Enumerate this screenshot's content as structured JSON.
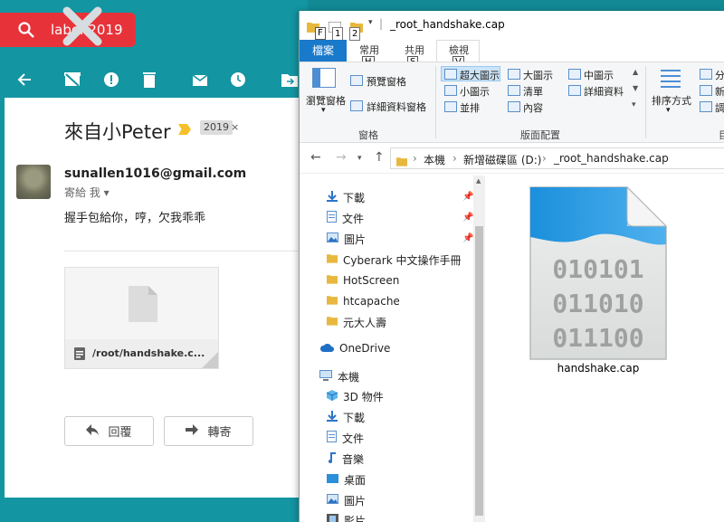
{
  "gmail": {
    "search_text": "label:2019",
    "subject": "來自小Peter",
    "tag": "2019",
    "tag_close": "×",
    "from": "sunallen1016@gmail.com",
    "to": "寄給 我",
    "body": "握手包給你，哼，欠我乖乖",
    "attachment_name": "/root/handshake.c...",
    "reply_label": "回覆",
    "forward_label": "轉寄"
  },
  "explorer": {
    "title": "_root_handshake.cap",
    "quick_access_keys": [
      "1",
      "2"
    ],
    "tabs": {
      "file": "檔案",
      "home": "常用",
      "share": "共用",
      "view": "檢視"
    },
    "keytips": {
      "file": "F",
      "home": "H",
      "share": "S",
      "view": "V"
    },
    "ribbon": {
      "nav_pane": "瀏覽窗格",
      "preview_pane": "預覽窗格",
      "details_pane": "詳細資料窗格",
      "panes_group": "窗格",
      "xl_icons": "超大圖示",
      "large_icons": "大圖示",
      "medium_icons": "中圖示",
      "small_icons": "小圖示",
      "list": "清單",
      "details": "詳細資料",
      "tiles": "並排",
      "content": "內容",
      "layout_group": "版面配置",
      "sort_by": "排序方式",
      "partial_1": "分",
      "partial_2": "新",
      "partial_3": "調",
      "partial_group": "目"
    },
    "address": {
      "crumbs": [
        "本機",
        "新增磁碟區 (D:)",
        "_root_handshake.cap"
      ]
    },
    "nav_items": [
      {
        "label": "下載",
        "icon": "download-icon",
        "pinned": true
      },
      {
        "label": "文件",
        "icon": "document-icon",
        "pinned": true
      },
      {
        "label": "圖片",
        "icon": "picture-icon",
        "pinned": true
      },
      {
        "label": "Cyberark 中文操作手冊",
        "icon": "folder-icon",
        "pinned": false
      },
      {
        "label": "HotScreen",
        "icon": "folder-icon",
        "pinned": false
      },
      {
        "label": "htcapache",
        "icon": "folder-icon",
        "pinned": false
      },
      {
        "label": "元大人壽",
        "icon": "folder-icon",
        "pinned": false
      },
      {
        "label": "OneDrive",
        "icon": "cloud-icon",
        "pinned": false
      },
      {
        "label": "本機",
        "icon": "computer-icon",
        "pinned": false
      },
      {
        "label": "3D 物件",
        "icon": "cube-icon",
        "pinned": false
      },
      {
        "label": "下載",
        "icon": "download-icon",
        "pinned": false
      },
      {
        "label": "文件",
        "icon": "document-icon",
        "pinned": false
      },
      {
        "label": "音樂",
        "icon": "music-icon",
        "pinned": false
      },
      {
        "label": "桌面",
        "icon": "desktop-icon",
        "pinned": false
      },
      {
        "label": "圖片",
        "icon": "picture-icon",
        "pinned": false
      },
      {
        "label": "影片",
        "icon": "video-icon",
        "pinned": false
      }
    ],
    "file": {
      "name": "handshake.cap",
      "binary_lines": [
        "010101",
        "011010",
        "011100"
      ]
    }
  },
  "colors": {
    "gmail_teal": "#1395a2",
    "search_red": "#e8323a",
    "file_tab_blue": "#1979ca",
    "tag_yellow": "#f6c02c"
  }
}
